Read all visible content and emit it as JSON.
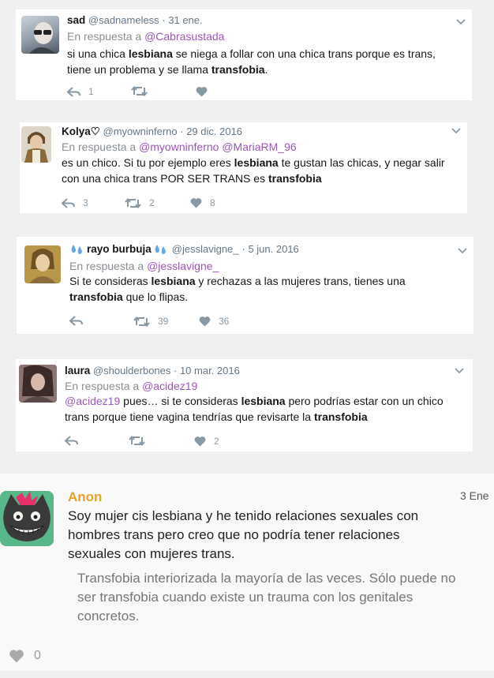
{
  "tweets": [
    {
      "name": "sad",
      "handle": "@sadnameless",
      "date": "· 31 ene.",
      "reply_prefix": "En respuesta a",
      "reply_to": "@Cabrasustada",
      "line1_a": "si una chica ",
      "line1_b": "lesbiana",
      "line1_c": " se niega a follar con una chica trans porque es trans,",
      "line2_a": "tiene un problema y se llama ",
      "line2_b": "transfobia",
      "line2_c": ".",
      "replies": "1",
      "retweets": "",
      "likes": ""
    },
    {
      "name": "Kolya♡",
      "handle": "@myowninferno",
      "date": "· 29 dic. 2016",
      "reply_prefix": "En respuesta a",
      "reply_to": "@myowninferno @MariaRM_96",
      "line1_a": "es un chico. Si tu por ejemplo eres ",
      "line1_b": "lesbiana",
      "line1_c": " te gustan las chicas, y negar salir",
      "line2_a": "con una chica trans POR SER TRANS es ",
      "line2_b": "transfobia",
      "line2_c": "",
      "replies": "3",
      "retweets": "2",
      "likes": "8"
    },
    {
      "name": "rayo burbuja",
      "handle": "@jesslavigne_",
      "date": "· 5 jun. 2016",
      "reply_prefix": "En respuesta a",
      "reply_to": "@jesslavigne_",
      "line1_a": "Si te consideras ",
      "line1_b": "lesbiana",
      "line1_c": " y rechazas a las mujeres trans, tienes una",
      "line2_a": "",
      "line2_b": "transfobia",
      "line2_c": " que lo flipas.",
      "replies": "",
      "retweets": "39",
      "likes": "36"
    },
    {
      "name": "laura",
      "handle": "@shoulderbones",
      "date": "· 10 mar. 2016",
      "reply_prefix": "En respuesta a",
      "reply_to": "@acidez19",
      "mention": "@acidez19",
      "line1_a": " pues… si te consideras ",
      "line1_b": "lesbiana",
      "line1_c": " pero podrías estar con un chico",
      "line2_a": "trans porque tiene vagina tendrías que revisarte la ",
      "line2_b": "transfobia",
      "line2_c": "",
      "replies": "",
      "retweets": "",
      "likes": "2"
    }
  ],
  "anon": {
    "name": "Anon",
    "date": "3 Ene",
    "text_lines": [
      "Soy mujer cis lesbiana y he tenido relaciones sexuales con",
      "hombres trans pero creo que no podría tener relaciones",
      "sexuales con mujeres trans."
    ],
    "reply_lines": [
      "Transfobia interiorizada la mayoría de las veces. Sólo puede no",
      "ser transfobia cuando existe un trauma con los genitales",
      "concretos."
    ],
    "likes": "0"
  },
  "icons": {
    "reply": "reply-icon",
    "retweet": "retweet-icon",
    "like": "heart-icon",
    "caret": "chevron-down-icon",
    "droplets": "sweat-droplets-icon"
  },
  "colors": {
    "accent_purple": "#9a58b5",
    "anon_orange": "#e6a224"
  }
}
